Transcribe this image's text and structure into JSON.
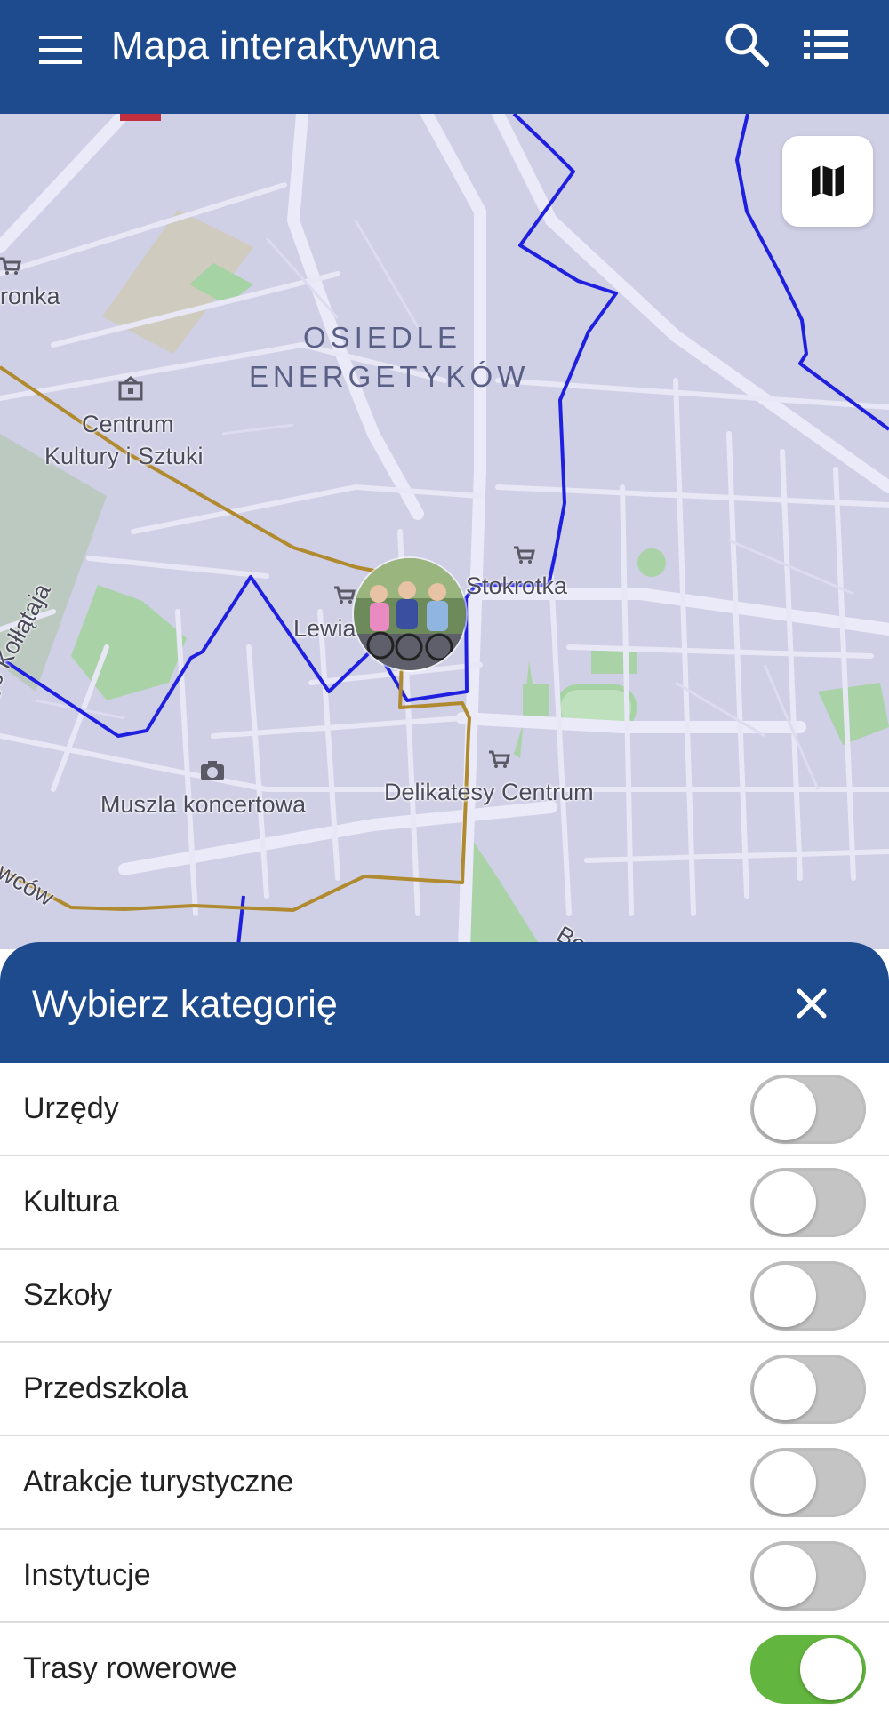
{
  "header": {
    "title": "Mapa interaktywna",
    "menu_icon": "hamburger-menu-icon",
    "search_icon": "search-icon",
    "list_icon": "list-view-icon",
    "bg_color": "#1e4a8e"
  },
  "map": {
    "labels": {
      "district_line1": "OSIEDLE",
      "district_line2": "ENERGETYKÓW",
      "ronka": "ronka",
      "centrum_1": "Centrum",
      "centrum_2": "Kultury i Sztuki",
      "kollataja": "go Kołłątaja",
      "stokrotka": "Stokrotka",
      "lewiatan": "Lewia",
      "muszla": "Muszla koncertowa",
      "delikatesy": "Delikatesy Centrum",
      "owcow": "owców",
      "bo": "Bo"
    },
    "route_colors": {
      "border": "#1f1fe0",
      "bike_route": "#b08a2e"
    },
    "layer_button_icon": "map-layers-icon"
  },
  "panel": {
    "title": "Wybierz kategorię",
    "close_icon": "close-icon",
    "categories": [
      {
        "label": "Urzędy",
        "on": false
      },
      {
        "label": "Kultura",
        "on": false
      },
      {
        "label": "Szkoły",
        "on": false
      },
      {
        "label": "Przedszkola",
        "on": false
      },
      {
        "label": "Atrakcje turystyczne",
        "on": false
      },
      {
        "label": "Instytucje",
        "on": false
      },
      {
        "label": "Trasy rowerowe",
        "on": true
      }
    ],
    "toggle_on_color": "#62b53e",
    "toggle_off_color": "#c4c4c4"
  }
}
